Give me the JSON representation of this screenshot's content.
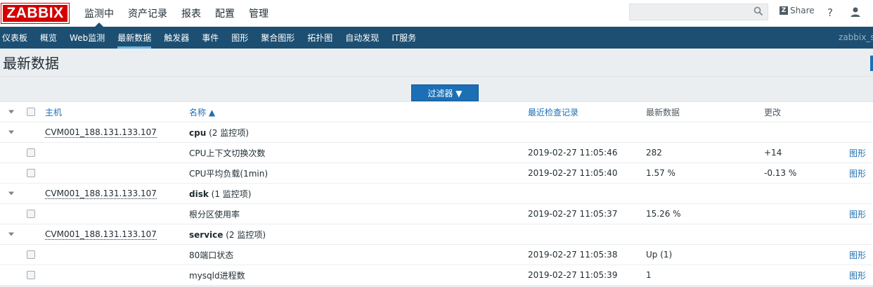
{
  "logo": "ZABBIX",
  "top_menu": [
    {
      "label": "监测中",
      "active": true
    },
    {
      "label": "资产记录",
      "active": false
    },
    {
      "label": "报表",
      "active": false
    },
    {
      "label": "配置",
      "active": false
    },
    {
      "label": "管理",
      "active": false
    }
  ],
  "search": {
    "placeholder": ""
  },
  "share_label": "Share",
  "help_label": "?",
  "sub_menu": [
    {
      "label": "仪表板",
      "active": false
    },
    {
      "label": "概览",
      "active": false
    },
    {
      "label": "Web监测",
      "active": false
    },
    {
      "label": "最新数据",
      "active": true
    },
    {
      "label": "触发器",
      "active": false
    },
    {
      "label": "事件",
      "active": false
    },
    {
      "label": "图形",
      "active": false
    },
    {
      "label": "聚合图形",
      "active": false
    },
    {
      "label": "拓扑图",
      "active": false
    },
    {
      "label": "自动发现",
      "active": false
    },
    {
      "label": "IT服务",
      "active": false
    }
  ],
  "username": "zabbix_se",
  "page_title": "最新数据",
  "filter_label": "过滤器 ▼",
  "table": {
    "headers": {
      "host": "主机",
      "name": "名称 ▲",
      "last_check": "最近检查记录",
      "last_value": "最新数据",
      "change": "更改"
    },
    "groups": [
      {
        "host": "CVM001_188.131.133.107",
        "app": "cpu",
        "count": "(2 监控项)",
        "items": [
          {
            "name": "CPU上下文切换次数",
            "time": "2019-02-27 11:05:46",
            "value": "282",
            "change": "+14",
            "graph": "图形"
          },
          {
            "name": "CPU平均负载(1min)",
            "time": "2019-02-27 11:05:40",
            "value": "1.57 %",
            "change": "-0.13 %",
            "graph": "图形"
          }
        ]
      },
      {
        "host": "CVM001_188.131.133.107",
        "app": "disk",
        "count": "(1 监控项)",
        "items": [
          {
            "name": "根分区使用率",
            "time": "2019-02-27 11:05:37",
            "value": "15.26 %",
            "change": "",
            "graph": "图形"
          }
        ]
      },
      {
        "host": "CVM001_188.131.133.107",
        "app": "service",
        "count": "(2 监控项)",
        "items": [
          {
            "name": "80端口状态",
            "time": "2019-02-27 11:05:38",
            "value": "Up (1)",
            "change": "",
            "graph": "图形"
          },
          {
            "name": "mysqld进程数",
            "time": "2019-02-27 11:05:39",
            "value": "1",
            "change": "",
            "graph": "图形"
          }
        ]
      }
    ]
  }
}
